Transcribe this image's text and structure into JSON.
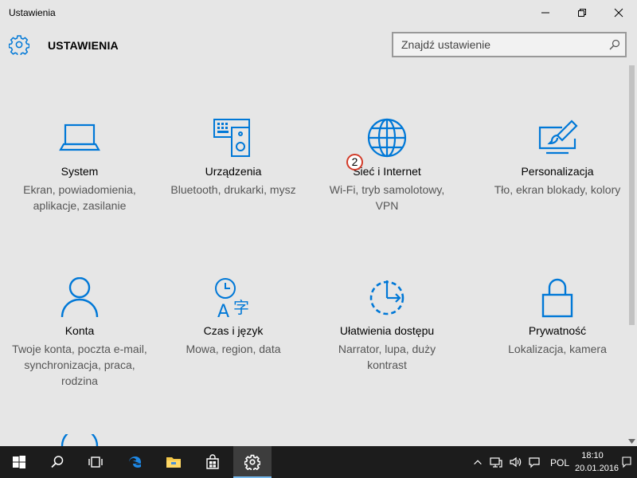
{
  "window": {
    "title": "Ustawienia"
  },
  "header": {
    "page_title": "USTAWIENIA"
  },
  "search": {
    "placeholder": "Znajdź ustawienie"
  },
  "tiles": [
    {
      "name": "System",
      "description": "Ekran, powiadomienia, aplikacje, zasilanie",
      "icon": "laptop-icon"
    },
    {
      "name": "Urządzenia",
      "description": "Bluetooth, drukarki, mysz",
      "icon": "devices-icon"
    },
    {
      "name": "Sieć i Internet",
      "description": "Wi-Fi, tryb samolotowy, VPN",
      "icon": "globe-icon"
    },
    {
      "name": "Personalizacja",
      "description": "Tło, ekran blokady, kolory",
      "icon": "personalization-icon"
    },
    {
      "name": "Konta",
      "description": "Twoje konta, poczta e-mail, synchronizacja, praca, rodzina",
      "icon": "person-icon"
    },
    {
      "name": "Czas i język",
      "description": "Mowa, region, data",
      "icon": "time-language-icon"
    },
    {
      "name": "Ułatwienia dostępu",
      "description": "Narrator, lupa, duży kontrast",
      "icon": "ease-of-access-icon"
    },
    {
      "name": "Prywatność",
      "description": "Lokalizacja, kamera",
      "icon": "lock-icon"
    }
  ],
  "badge": {
    "number": "2"
  },
  "taskbar": {
    "language": "POL",
    "time": "18:10",
    "date": "20.01.2016"
  },
  "colors": {
    "accent": "#0078d7",
    "background": "#e6e6e6",
    "taskbar": "#1c1c1c"
  }
}
